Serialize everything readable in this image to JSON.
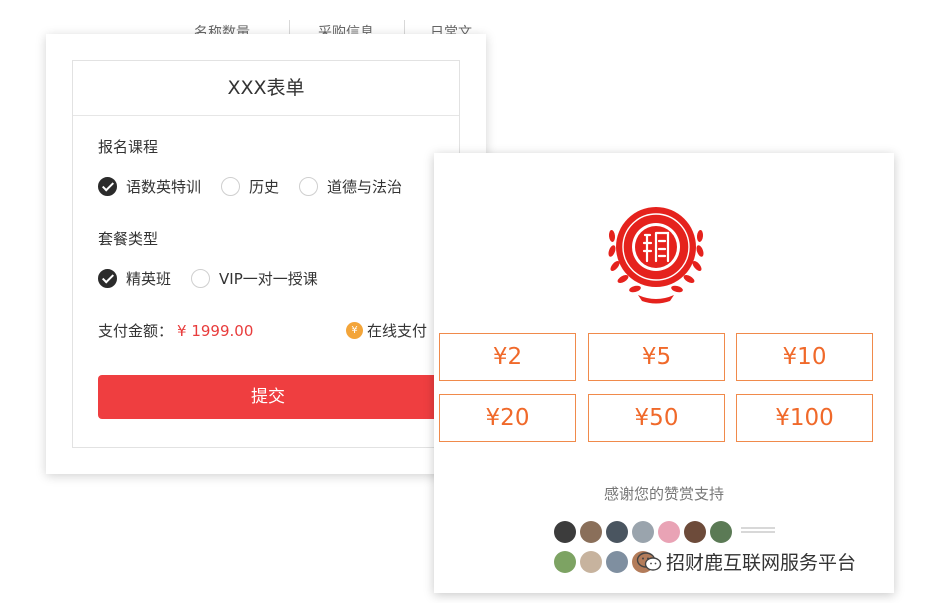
{
  "background_tabs": [
    "名称数量",
    "采购信息",
    "日常文"
  ],
  "form": {
    "title": "XXX表单",
    "course_label": "报名课程",
    "course_options": [
      {
        "label": "语数英特训",
        "checked": true
      },
      {
        "label": "历史",
        "checked": false
      },
      {
        "label": "道德与法治",
        "checked": false
      }
    ],
    "package_label": "套餐类型",
    "package_options": [
      {
        "label": "精英班",
        "checked": true
      },
      {
        "label": "VIP一对一授课",
        "checked": false
      }
    ],
    "pay_label": "支付金额：",
    "pay_amount": "¥ 1999.00",
    "online_pay_label": "在线支付",
    "coin_symbol": "¥",
    "submit_label": "提交"
  },
  "donate": {
    "amounts": [
      "¥2",
      "¥5",
      "¥10",
      "¥20",
      "¥50",
      "¥100"
    ],
    "thanks_text": "感谢您的赞赏支持"
  },
  "watermark": {
    "text": "招财鹿互联网服务平台"
  },
  "colors": {
    "accent_red": "#ef3e40",
    "amount_red": "#e83c3c",
    "donate_orange": "#f08a4b",
    "seal_red": "#e5221d",
    "checked_radio": "#2b2b2b"
  }
}
